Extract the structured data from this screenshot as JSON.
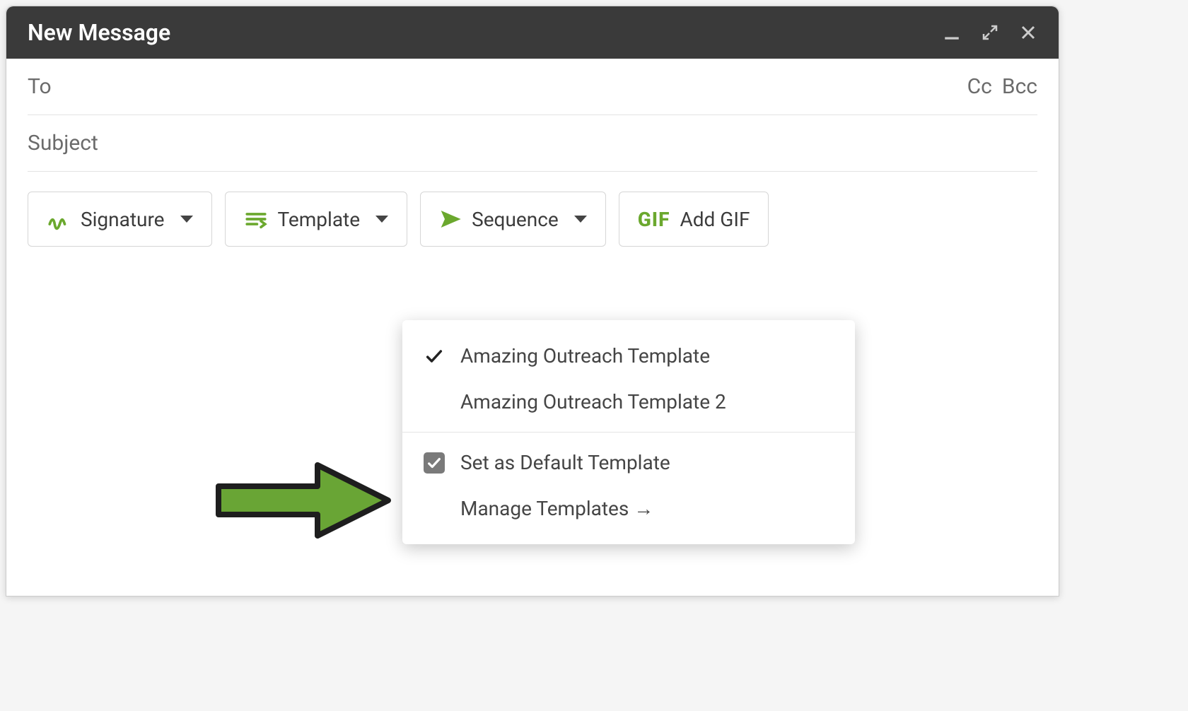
{
  "window": {
    "title": "New Message"
  },
  "fields": {
    "to_label": "To",
    "cc_label": "Cc",
    "bcc_label": "Bcc",
    "subject_label": "Subject"
  },
  "toolbar": {
    "signature_label": "Signature",
    "template_label": "Template",
    "sequence_label": "Sequence",
    "gif_prefix": "GIF",
    "gif_label": "Add GIF"
  },
  "template_dropdown": {
    "items": [
      {
        "label": "Amazing Outreach Template",
        "selected": true
      },
      {
        "label": "Amazing Outreach Template 2",
        "selected": false
      }
    ],
    "set_default_label": "Set as Default Template",
    "set_default_checked": true,
    "manage_label": "Manage Templates →"
  },
  "colors": {
    "accent": "#6ba82e",
    "header_bg": "#3a3a3a"
  }
}
